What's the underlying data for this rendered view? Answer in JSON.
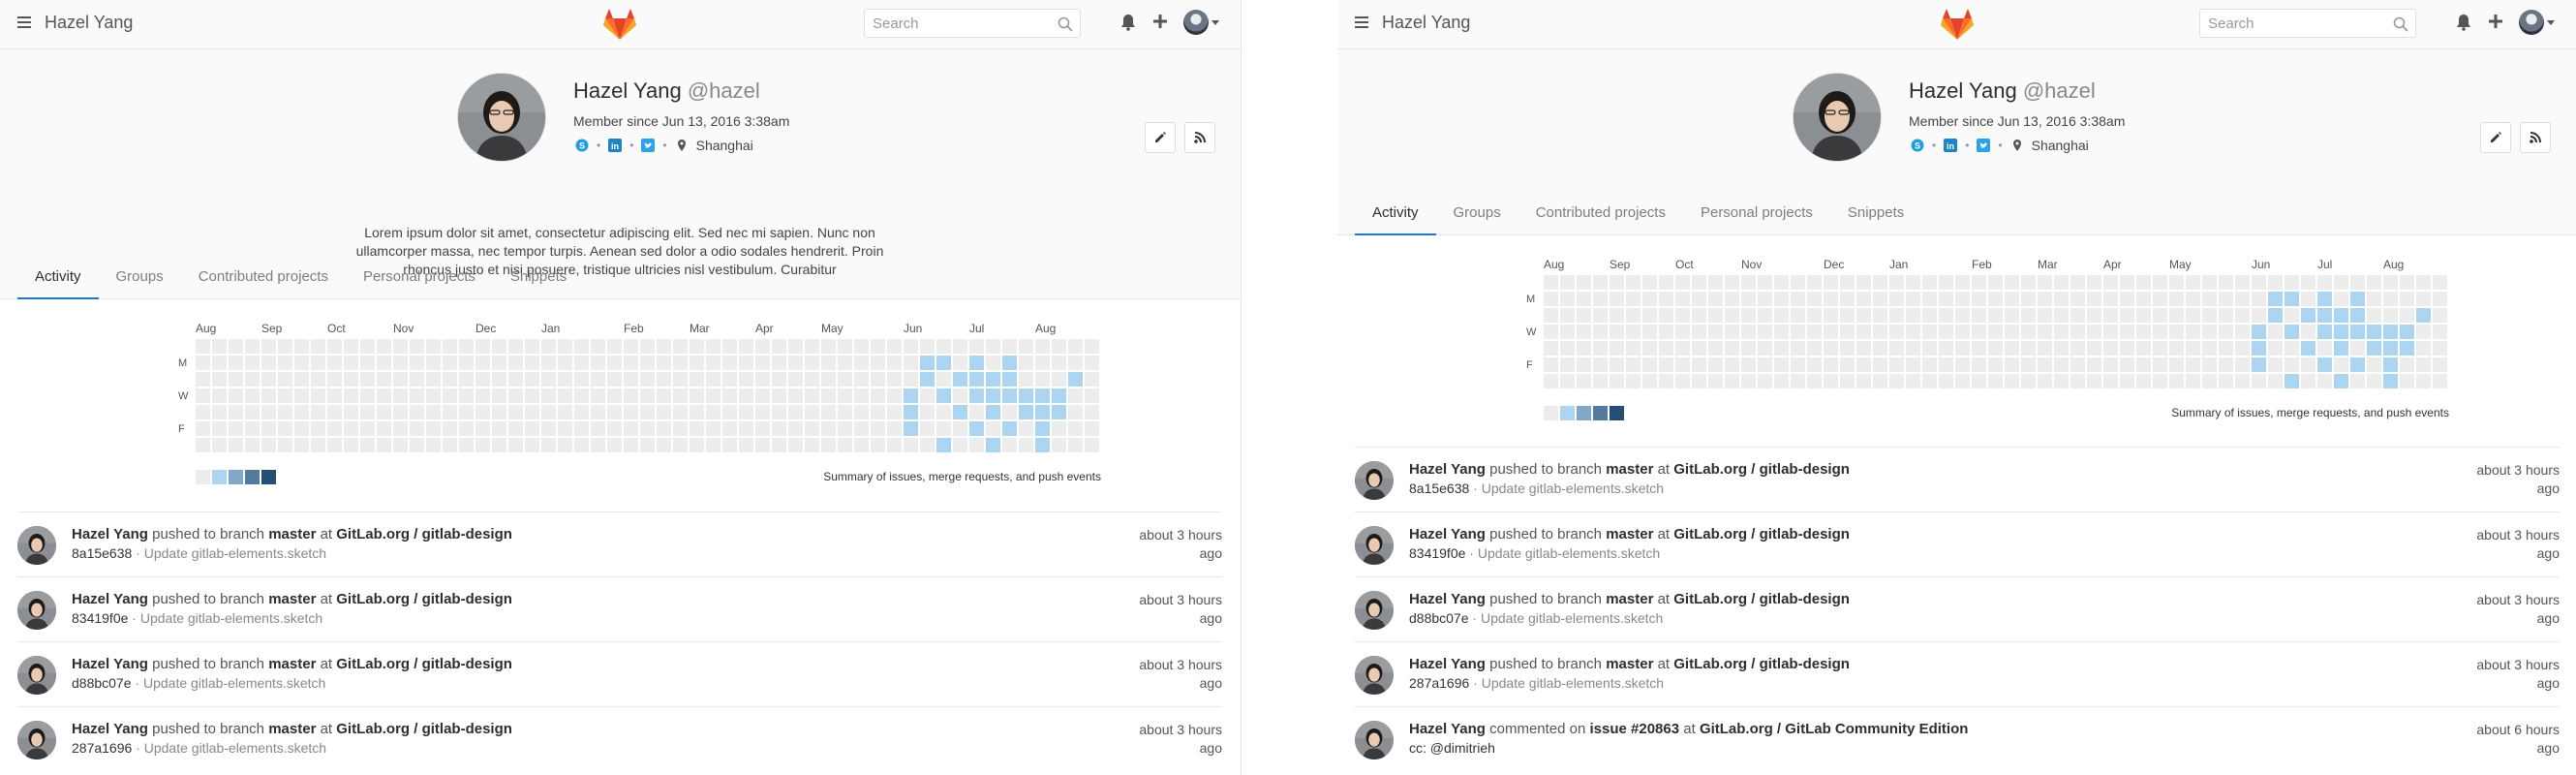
{
  "app": {
    "title": "Hazel Yang",
    "search_placeholder": "Search"
  },
  "colors": {
    "accent": "#1f78d1",
    "logo_orange": "#fc6d26",
    "logo_red": "#e24329",
    "logo_yellow": "#fca326",
    "cal_levels": [
      "#ededed",
      "#acd5f2",
      "#7fa8c9",
      "#527ba0",
      "#254e77"
    ]
  },
  "icons": [
    "menu-icon",
    "gitlab-logo-icon",
    "search-icon",
    "bell-icon",
    "plus-icon",
    "caret-down-icon",
    "pencil-icon",
    "rss-icon",
    "skype-icon",
    "linkedin-icon",
    "twitter-icon",
    "location-pin-icon"
  ],
  "profile": {
    "name": "Hazel Yang",
    "handle": "@hazel",
    "member_since": "Member since Jun 13, 2016 3:38am",
    "location": "Shanghai",
    "bio": "Lorem ipsum dolor sit amet, consectetur adipiscing elit. Sed nec mi sapien. Nunc non ullamcorper massa, nec tempor turpis. Aenean sed dolor a odio sodales hendrerit. Proin rhoncus justo et nisi posuere, tristique ultricies nisl vestibulum. Curabitur"
  },
  "tabs": [
    "Activity",
    "Groups",
    "Contributed projects",
    "Personal projects",
    "Snippets"
  ],
  "calendar": {
    "months": [
      "Aug",
      "Sep",
      "Oct",
      "Nov",
      "Dec",
      "Jan",
      "Feb",
      "Mar",
      "Apr",
      "May",
      "Jun",
      "Jul",
      "Aug"
    ],
    "day_labels": [
      "M",
      "W",
      "F"
    ],
    "summary": "Summary of issues, merge requests, and push events",
    "active_cells": [
      [
        44,
        1
      ],
      [
        45,
        1
      ],
      [
        47,
        1
      ],
      [
        49,
        1
      ],
      [
        44,
        2
      ],
      [
        46,
        2
      ],
      [
        47,
        2
      ],
      [
        48,
        2
      ],
      [
        49,
        2
      ],
      [
        53,
        2
      ],
      [
        43,
        3
      ],
      [
        45,
        3
      ],
      [
        47,
        3
      ],
      [
        48,
        3
      ],
      [
        49,
        3
      ],
      [
        50,
        3
      ],
      [
        51,
        3
      ],
      [
        52,
        3
      ],
      [
        43,
        4
      ],
      [
        46,
        4
      ],
      [
        48,
        4
      ],
      [
        50,
        4
      ],
      [
        51,
        4
      ],
      [
        52,
        4
      ],
      [
        43,
        5
      ],
      [
        47,
        5
      ],
      [
        49,
        5
      ],
      [
        51,
        5
      ],
      [
        45,
        6
      ],
      [
        48,
        6
      ],
      [
        51,
        6
      ]
    ]
  },
  "feed_left": [
    {
      "author": "Hazel Yang",
      "action": "pushed to branch",
      "target": "master",
      "at": "at",
      "project": "GitLab.org / gitlab-design",
      "sha": "8a15e638",
      "message": "Update gitlab-elements.sketch",
      "time1": "about 3 hours",
      "time2": "ago"
    },
    {
      "author": "Hazel Yang",
      "action": "pushed to branch",
      "target": "master",
      "at": "at",
      "project": "GitLab.org / gitlab-design",
      "sha": "83419f0e",
      "message": "Update gitlab-elements.sketch",
      "time1": "about 3 hours",
      "time2": "ago"
    },
    {
      "author": "Hazel Yang",
      "action": "pushed to branch",
      "target": "master",
      "at": "at",
      "project": "GitLab.org / gitlab-design",
      "sha": "d88bc07e",
      "message": "Update gitlab-elements.sketch",
      "time1": "about 3 hours",
      "time2": "ago"
    },
    {
      "author": "Hazel Yang",
      "action": "pushed to branch",
      "target": "master",
      "at": "at",
      "project": "GitLab.org / gitlab-design",
      "sha": "287a1696",
      "message": "Update gitlab-elements.sketch",
      "time1": "about 3 hours",
      "time2": "ago"
    }
  ],
  "feed_right": [
    {
      "author": "Hazel Yang",
      "action": "pushed to branch",
      "target": "master",
      "at": "at",
      "project": "GitLab.org / gitlab-design",
      "sha": "8a15e638",
      "message": "Update gitlab-elements.sketch",
      "time1": "about 3 hours",
      "time2": "ago"
    },
    {
      "author": "Hazel Yang",
      "action": "pushed to branch",
      "target": "master",
      "at": "at",
      "project": "GitLab.org / gitlab-design",
      "sha": "83419f0e",
      "message": "Update gitlab-elements.sketch",
      "time1": "about 3 hours",
      "time2": "ago"
    },
    {
      "author": "Hazel Yang",
      "action": "pushed to branch",
      "target": "master",
      "at": "at",
      "project": "GitLab.org / gitlab-design",
      "sha": "d88bc07e",
      "message": "Update gitlab-elements.sketch",
      "time1": "about 3 hours",
      "time2": "ago"
    },
    {
      "author": "Hazel Yang",
      "action": "pushed to branch",
      "target": "master",
      "at": "at",
      "project": "GitLab.org / gitlab-design",
      "sha": "287a1696",
      "message": "Update gitlab-elements.sketch",
      "time1": "about 3 hours",
      "time2": "ago"
    },
    {
      "author": "Hazel Yang",
      "action": "commented on",
      "target": "issue #20863",
      "at": "at",
      "project": "GitLab.org / GitLab Community Edition",
      "sha": "cc: @dimitrieh",
      "message": "",
      "time1": "about 6 hours",
      "time2": "ago"
    }
  ]
}
